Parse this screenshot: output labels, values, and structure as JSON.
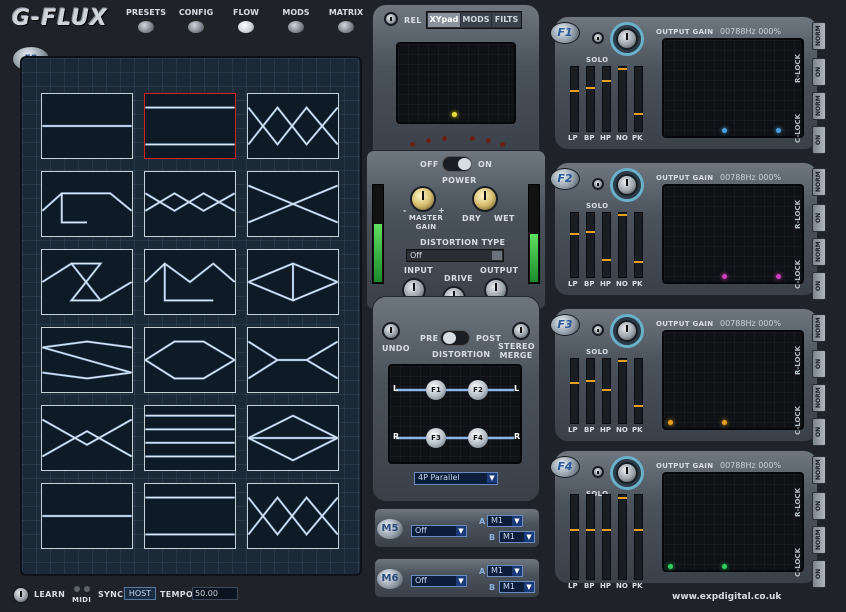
{
  "app": {
    "logo": "G-FLUX",
    "website": "www.expdigital.co.uk",
    "badge": "ΣS"
  },
  "nav": {
    "items": [
      "PRESETS",
      "CONFIG",
      "FLOW",
      "MODS",
      "MATRIX"
    ]
  },
  "center": {
    "tabs": {
      "rel": "REL",
      "xypad": "XYpad",
      "mods": "MODS",
      "filts": "FILTS"
    },
    "power": {
      "off": "OFF",
      "on": "ON",
      "label": "POWER"
    },
    "master_gain": "MASTER GAIN",
    "dry": "DRY",
    "wet": "WET",
    "minus": "-",
    "plus": "+",
    "distortion_type_label": "DISTORTION TYPE",
    "distortion_type_value": "Off",
    "input": "INPUT",
    "drive": "DRIVE",
    "output": "OUTPUT",
    "undo": "UNDO",
    "pre": "PRE",
    "post": "POST",
    "distortion": "DISTORTION",
    "stereo_merge": "STEREO MERGE",
    "routing": {
      "l": "L",
      "r": "R",
      "f1": "F1",
      "f2": "F2",
      "f3": "F3",
      "f4": "F4"
    },
    "routing_preset": "4P Parallel",
    "m5": {
      "label": "M5",
      "value": "Off",
      "a": "A",
      "b": "B",
      "a_val": "M1",
      "b_val": "M1"
    },
    "m6": {
      "label": "M6",
      "value": "Off",
      "a": "A",
      "b": "B",
      "a_val": "M1",
      "b_val": "M1"
    }
  },
  "filters": [
    {
      "id": "F1",
      "solo": "SOLO",
      "out_gain": "OUTPUT GAIN",
      "readout": "00788Hz 000%",
      "faders": [
        "LP",
        "BP",
        "HP",
        "NO",
        "PK"
      ],
      "levels": [
        0.65,
        0.7,
        0.8,
        0.98,
        0.3
      ],
      "dot_color": "#4aa0e0"
    },
    {
      "id": "F2",
      "solo": "SOLO",
      "out_gain": "OUTPUT GAIN",
      "readout": "00788Hz 000%",
      "faders": [
        "LP",
        "BP",
        "HP",
        "NO",
        "PK"
      ],
      "levels": [
        0.7,
        0.72,
        0.3,
        0.98,
        0.28
      ],
      "dot_color": "#d040c0"
    },
    {
      "id": "F3",
      "solo": "SOLO",
      "out_gain": "OUTPUT GAIN",
      "readout": "00788Hz 000%",
      "faders": [
        "LP",
        "BP",
        "HP",
        "NO",
        "PK"
      ],
      "levels": [
        0.65,
        0.68,
        0.55,
        0.98,
        0.3
      ],
      "dot_color": "#e8a020"
    },
    {
      "id": "F4",
      "solo": "SOLO",
      "out_gain": "OUTPUT GAIN",
      "readout": "00788Hz 000%",
      "faders": [
        "LP",
        "BP",
        "HP",
        "NO",
        "PK"
      ],
      "levels": [
        0.6,
        0.6,
        0.6,
        0.98,
        0.6
      ],
      "dot_color": "#30d060"
    }
  ],
  "side": {
    "rlock": "R-LOCK",
    "clock": "C-LOCK",
    "norm": "NORM",
    "on": "ON"
  },
  "bottom": {
    "learn": "LEARN",
    "midi": "MIDI",
    "sync": "SYNC",
    "host": "HOST",
    "tempo": "TEMPO",
    "tempo_value": "50.00"
  }
}
